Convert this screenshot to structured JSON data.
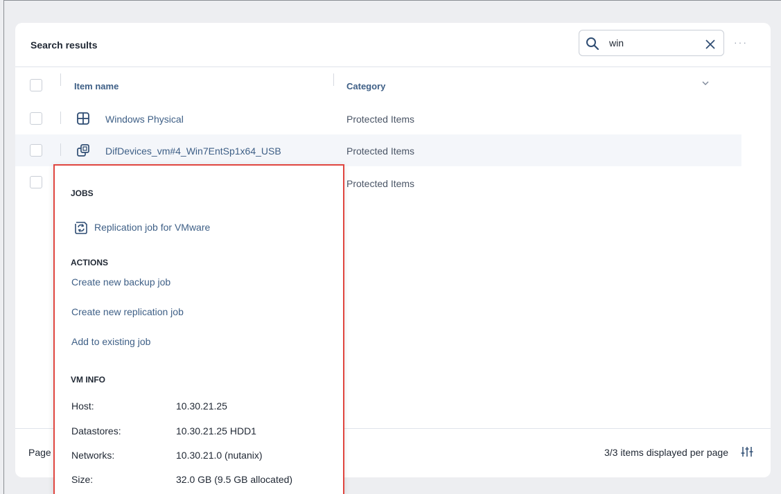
{
  "header": {
    "title": "Search results",
    "search_value": "win",
    "more_label": "···"
  },
  "columns": {
    "item_name": "Item name",
    "category": "Category"
  },
  "rows": [
    {
      "name": "Windows Physical",
      "category": "Protected Items",
      "icon": "windows-icon"
    },
    {
      "name": "DifDevices_vm#4_Win7EntSp1x64_USB",
      "category": "Protected Items",
      "icon": "vm-icon"
    },
    {
      "name": "",
      "category": "Protected Items",
      "icon": ""
    }
  ],
  "footer": {
    "page_label": "Page",
    "per_page_text": "3/3 items displayed per page"
  },
  "popup": {
    "jobs_title": "JOBS",
    "job_link": "Replication job for VMware",
    "actions_title": "ACTIONS",
    "actions": [
      "Create new backup job",
      "Create new replication job",
      "Add to existing job"
    ],
    "vm_info_title": "VM INFO",
    "vm_info": [
      {
        "label": "Host:",
        "value": "10.30.21.25"
      },
      {
        "label": "Datastores:",
        "value": "10.30.21.25 HDD1"
      },
      {
        "label": "Networks:",
        "value": "10.30.21.0 (nutanix)"
      },
      {
        "label": "Size:",
        "value": "32.0 GB (9.5 GB allocated)"
      }
    ]
  },
  "colors": {
    "link": "#3e5f86",
    "highlight_border": "#e0453f",
    "background": "#edeef1"
  }
}
